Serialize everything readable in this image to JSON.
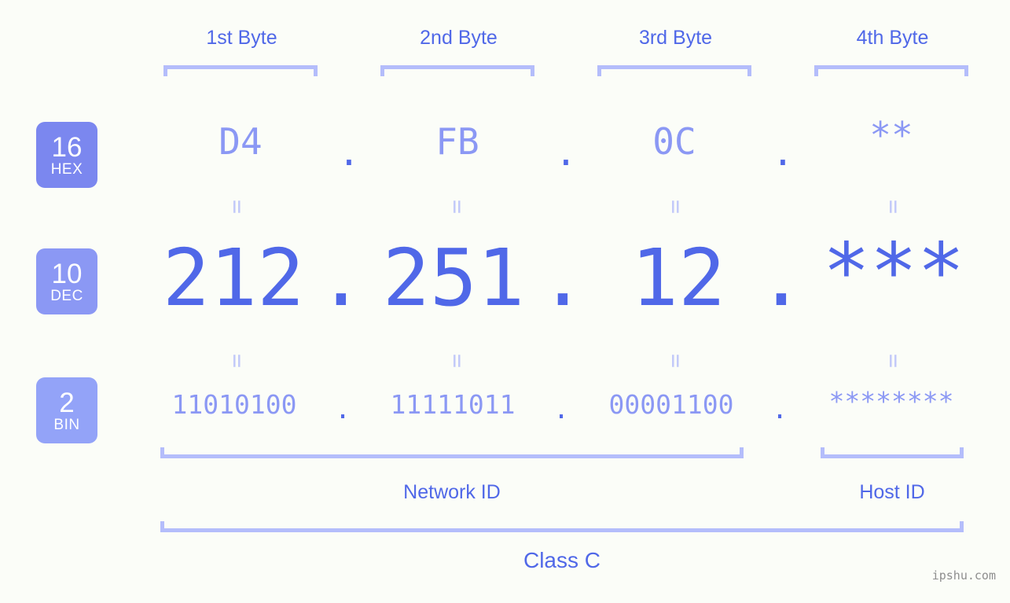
{
  "columns": [
    {
      "label": "1st Byte",
      "hex": "D4",
      "dec": "212",
      "bin": "11010100"
    },
    {
      "label": "2nd Byte",
      "hex": "FB",
      "dec": "251",
      "bin": "11111011"
    },
    {
      "label": "3rd Byte",
      "hex": "0C",
      "dec": "12",
      "bin": "00001100"
    },
    {
      "label": "4th Byte",
      "hex": "**",
      "dec": "***",
      "bin": "********"
    }
  ],
  "separators": {
    "hex": ".",
    "dec": ".",
    "bin": "."
  },
  "bases": [
    {
      "num": "16",
      "abbr": "HEX",
      "color": "#7b87ef"
    },
    {
      "num": "10",
      "abbr": "DEC",
      "color": "#8b98f4"
    },
    {
      "num": "2",
      "abbr": "BIN",
      "color": "#93a3f8"
    }
  ],
  "equals": "=",
  "footer": {
    "network_id": "Network ID",
    "host_id": "Host ID",
    "class": "Class C"
  },
  "watermark": "ipshu.com",
  "colors": {
    "background": "#fbfdf8",
    "primary": "#5068e8",
    "secondary": "#8b98f4",
    "bracket": "#b4bdfb",
    "equals": "#c3caf9",
    "watermark": "#8e8e8e"
  }
}
